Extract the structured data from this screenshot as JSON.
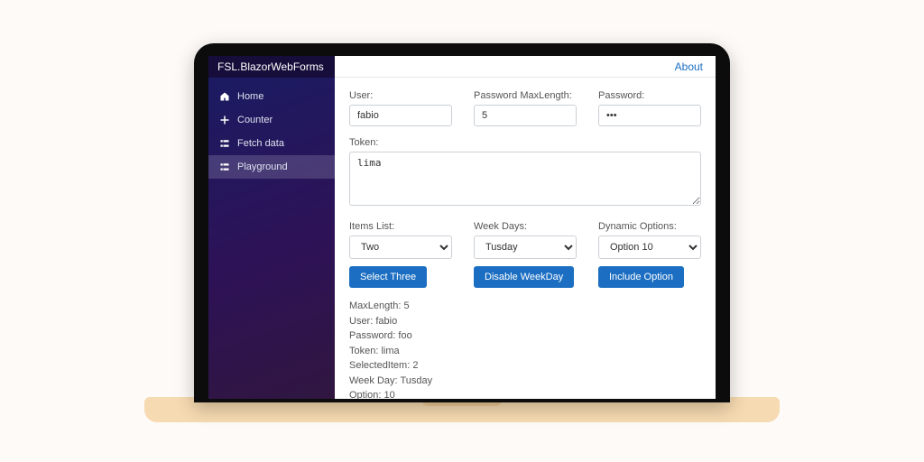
{
  "brand": "FSL.BlazorWebForms",
  "about_link": "About",
  "nav": {
    "items": [
      {
        "label": "Home",
        "icon": "home"
      },
      {
        "label": "Counter",
        "icon": "plus"
      },
      {
        "label": "Fetch data",
        "icon": "list"
      },
      {
        "label": "Playground",
        "icon": "list"
      }
    ],
    "active_index": 3
  },
  "form": {
    "user": {
      "label": "User:",
      "value": "fabio"
    },
    "maxlen": {
      "label": "Password MaxLength:",
      "value": "5"
    },
    "password": {
      "label": "Password:",
      "value": "foo",
      "masked": "•••"
    },
    "token": {
      "label": "Token:",
      "value": "lima"
    },
    "items_list": {
      "label": "Items List:",
      "value": "Two",
      "button": "Select Three"
    },
    "week_days": {
      "label": "Week Days:",
      "value": "Tusday",
      "button": "Disable WeekDay"
    },
    "dyn_opts": {
      "label": "Dynamic Options:",
      "value": "Option 10",
      "button": "Include Option"
    }
  },
  "summary": {
    "lines": [
      "MaxLength: 5",
      "User: fabio",
      "Password: foo",
      "Token: lima",
      "SelectedItem: 2",
      "Week Day: Tusday",
      "Option: 10"
    ]
  }
}
